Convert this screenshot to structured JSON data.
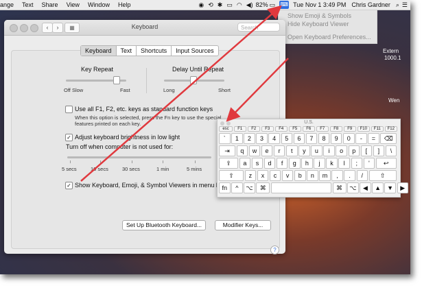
{
  "menubar": {
    "items": [
      "ange",
      "Text",
      "Share",
      "View",
      "Window",
      "Help"
    ],
    "battery": "82%",
    "datetime": "Tue Nov 1  3:49 PM",
    "user": "Chris Gardner"
  },
  "dropdown": {
    "items": [
      "Show Emoji & Symbols",
      "Hide Keyboard Viewer",
      "Open Keyboard Preferences..."
    ]
  },
  "window": {
    "title": "Keyboard",
    "search_placeholder": "Search",
    "tabs": [
      "Keyboard",
      "Text",
      "Shortcuts",
      "Input Sources"
    ],
    "active_tab": "Keyboard",
    "key_repeat": {
      "label": "Key Repeat",
      "min": "Off",
      "min2": "Slow",
      "max": "Fast"
    },
    "delay": {
      "label": "Delay Until Repeat",
      "min": "Long",
      "max": "Short"
    },
    "fn_option": {
      "label": "Use all F1, F2, etc. keys as standard function keys",
      "checked": false,
      "note1": "When this option is selected, press the Fn key to use the special",
      "note2": "features printed on each key."
    },
    "brightness": {
      "label": "Adjust keyboard brightness in low light",
      "checked": true
    },
    "turn_off": {
      "label": "Turn off when computer is not used for:",
      "ticks": [
        "5 secs",
        "10 secs",
        "30 secs",
        "1 min",
        "5 mins"
      ]
    },
    "show_viewers": {
      "label": "Show Keyboard, Emoji, & Symbol Viewers in menu bar",
      "checked": true
    },
    "buttons": {
      "bluetooth": "Set Up Bluetooth Keyboard...",
      "modifier": "Modifier Keys..."
    },
    "help": "?"
  },
  "desktop_label_1": "Extern",
  "desktop_label_2": "1000.1",
  "desktop_label_3": "Wen",
  "keyboard_viewer": {
    "title": "U.S.",
    "fn_row": [
      "esc",
      "F1",
      "F2",
      "F3",
      "F4",
      "F5",
      "F6",
      "F7",
      "F8",
      "F9",
      "F10",
      "F11",
      "F12"
    ],
    "row1": [
      "`",
      "1",
      "2",
      "3",
      "4",
      "5",
      "6",
      "7",
      "8",
      "9",
      "0",
      "-",
      "=",
      "⌫"
    ],
    "row2": [
      "⇥",
      "q",
      "w",
      "e",
      "r",
      "t",
      "y",
      "u",
      "i",
      "o",
      "p",
      "[",
      "]",
      "\\"
    ],
    "row3": [
      "⇪",
      "a",
      "s",
      "d",
      "f",
      "g",
      "h",
      "j",
      "k",
      "l",
      ";",
      "'",
      "↩"
    ],
    "row4": [
      "⇧",
      "z",
      "x",
      "c",
      "v",
      "b",
      "n",
      "m",
      ",",
      ".",
      "/",
      "⇧"
    ],
    "row5": [
      "fn",
      "^",
      "⌥",
      "⌘",
      "",
      "⌘",
      "⌥",
      "◀",
      "▲",
      "▼",
      "▶"
    ]
  },
  "colors": {
    "arrow": "#e0393e",
    "accent": "#2f6fe0"
  }
}
